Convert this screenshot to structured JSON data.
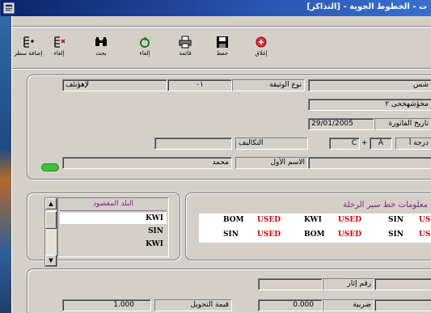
{
  "window": {
    "title": "ت - الخطوط الجوية - [التذاكر]"
  },
  "toolbar": {
    "add_line_label": "إضافة سطر",
    "cancel_line_label": "إلغاء",
    "search_label": "بحث",
    "cancel_label": "إلغاء",
    "list_label": "قائمة",
    "save_label": "حفظ",
    "close_label": "إغلاق"
  },
  "header": {
    "doc_type_label": "نوع الوثيقة",
    "doc_type_value": "٠١",
    "doc_type_desc": "لإهؤنئف",
    "name_value": "شس",
    "second_name_value": "مخؤشهخحی ٢",
    "invoice_date_label": "تاريخ الفاتورة",
    "invoice_date_value": "29/01/2005",
    "class_label": "درجة أ",
    "class_value": "A",
    "plus_sign": "+",
    "class_code": "C",
    "costs_label": "التكاليف",
    "first_name_label": "الاسم الأول",
    "first_name_value": "محمد"
  },
  "route": {
    "title": "معلومات خط سير الرحلة",
    "rows": [
      [
        "US",
        "SIN",
        "USED",
        "KWI",
        "USED",
        "BOM"
      ],
      [
        "US",
        "SIN",
        "USED",
        "BOM",
        "USED",
        "SIN"
      ]
    ]
  },
  "destination": {
    "header": "البلد المقصود",
    "items": [
      "KWI",
      "SIN",
      "KWI"
    ]
  },
  "footer": {
    "ticket_no_label": "رقم إثار",
    "tax_label": "ضريبة",
    "tax_value": "0.000",
    "conversion_label": "قيمة التحويل",
    "conversion_value": "1.000"
  },
  "colors": {
    "title_gradient_start": "#0a246a",
    "accent_purple": "#8b1c8b",
    "used_red": "#cc0000",
    "status_green": "#3fbf3a"
  }
}
